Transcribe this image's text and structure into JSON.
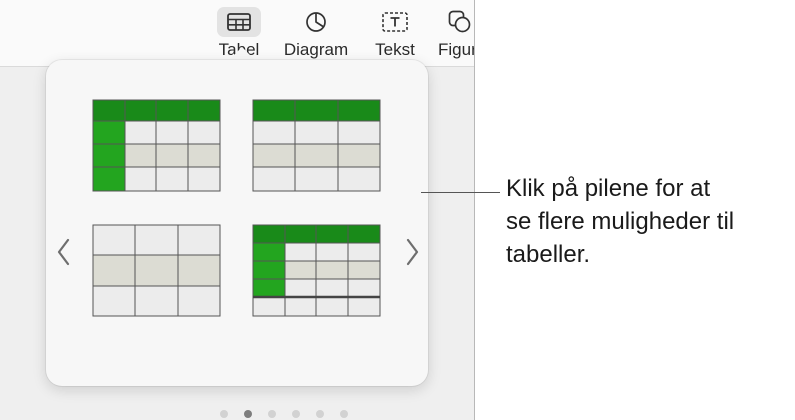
{
  "toolbar": {
    "items": [
      {
        "label": "Tabel",
        "icon": "table-icon"
      },
      {
        "label": "Diagram",
        "icon": "chart-icon"
      },
      {
        "label": "Tekst",
        "icon": "text-box-icon"
      },
      {
        "label": "Figur",
        "icon": "shapes-icon"
      }
    ]
  },
  "popover": {
    "templates": [
      {
        "name": "green-header-column-table"
      },
      {
        "name": "green-header-table"
      },
      {
        "name": "plain-gray-table"
      },
      {
        "name": "green-header-column-footer-table"
      }
    ],
    "page_count": 6,
    "active_page": 2,
    "prev_icon": "chevron-left-icon",
    "next_icon": "chevron-right-icon"
  },
  "callout": {
    "lines": [
      "Klik på pilene for at",
      "se flere muligheder til",
      "tabeller."
    ]
  },
  "colors": {
    "green_dark": "#198a19",
    "green_bright": "#23a51f",
    "cell_light": "#ececec",
    "cell_mid": "#dcdcd3",
    "grid_line": "#555555"
  }
}
